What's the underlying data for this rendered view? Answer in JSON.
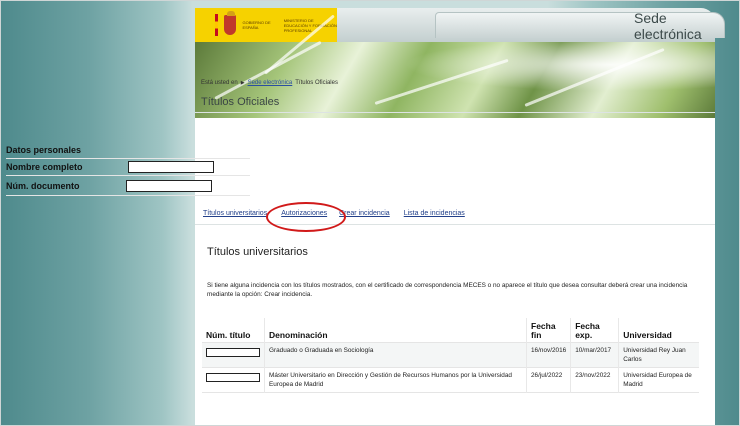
{
  "header": {
    "gov_text": "GOBIERNO DE ESPAÑA",
    "ministry_text": "MINISTERIO DE EDUCACIÓN Y FORMACIÓN PROFESIONAL",
    "sede": "Sede electrónica"
  },
  "breadcrumb": {
    "prefix": "Está usted en",
    "link": "Sede electrónica",
    "current": "Títulos Oficiales"
  },
  "page_title": "Títulos Oficiales",
  "personal_data": {
    "heading": "Datos personales",
    "name_label": "Nombre completo",
    "doc_label": "Núm. documento"
  },
  "tabs": [
    {
      "label": "Títulos universitarios"
    },
    {
      "label": "Autorizaciones"
    },
    {
      "label": "Crear incidencia"
    },
    {
      "label": "Lista de incidencias"
    }
  ],
  "section_title": "Títulos universitarios",
  "info_text": "Si tiene alguna incidencia con los títulos mostrados, con el certificado de correspondencia MECES o no aparece el título que desea consultar deberá crear una incidencia mediante la opción: Crear incidencia.",
  "table": {
    "headers": {
      "num": "Núm. título",
      "denominacion": "Denominación",
      "fecha_fin": "Fecha fin",
      "fecha_exp": "Fecha exp.",
      "universidad": "Universidad"
    },
    "rows": [
      {
        "denominacion": "Graduado o Graduada en Sociología",
        "fecha_fin": "16/nov/2016",
        "fecha_exp": "10/mar/2017",
        "universidad": "Universidad Rey Juan Carlos"
      },
      {
        "denominacion": "Máster Universitario en Dirección y Gestión de Recursos Humanos por la Universidad Europea de Madrid",
        "fecha_fin": "26/jul/2022",
        "fecha_exp": "23/nov/2022",
        "universidad": "Universidad Europea de Madrid"
      }
    ]
  },
  "colors": {
    "accent_red": "#d02a1e",
    "link_blue": "#22408a",
    "gov_yellow": "#f6d200"
  }
}
